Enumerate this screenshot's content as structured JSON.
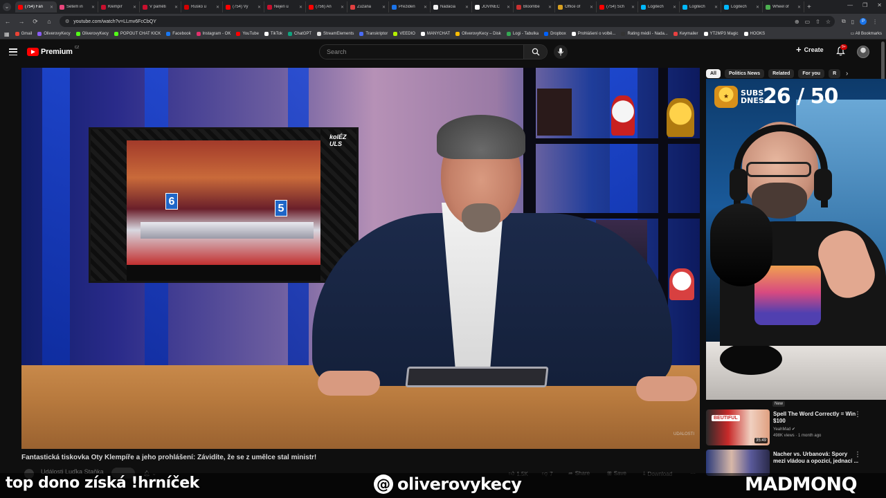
{
  "browser": {
    "tabs": [
      {
        "label": "(754) Fan",
        "color": "#ff0000",
        "active": true
      },
      {
        "label": "Šetem in",
        "color": "#e8467c"
      },
      {
        "label": "Klempíř",
        "color": "#c8102e"
      },
      {
        "label": "V paměti",
        "color": "#c8102e"
      },
      {
        "label": "Rusko u",
        "color": "#d40000"
      },
      {
        "label": "(754) Vy",
        "color": "#ff0000"
      },
      {
        "label": "Nejen u",
        "color": "#c8102e"
      },
      {
        "label": "(756) An",
        "color": "#ff0000"
      },
      {
        "label": "Zuzana",
        "color": "#e04040"
      },
      {
        "label": "Preziden",
        "color": "#1a73e8"
      },
      {
        "label": "Nadácia",
        "color": "#f1f1f1"
      },
      {
        "label": "JOVINEC",
        "color": "#ffffff"
      },
      {
        "label": "Bloombe",
        "color": "#c83030"
      },
      {
        "label": "Office of",
        "color": "#d8a020"
      },
      {
        "label": "(754) Sch",
        "color": "#ff0000"
      },
      {
        "label": "Logitech",
        "color": "#00b8fc"
      },
      {
        "label": "Logitech",
        "color": "#00b8fc"
      },
      {
        "label": "Logitech",
        "color": "#00b8fc"
      },
      {
        "label": "Wheel of",
        "color": "#4caf50"
      }
    ],
    "url": "youtube.com/watch?v=LLmv6FcCbQY",
    "bookmarks": [
      {
        "label": "Gmail",
        "color": "#ea4335"
      },
      {
        "label": "OliverovyKecy",
        "color": "#8a5cf6"
      },
      {
        "label": "OliverovyKecy",
        "color": "#53fc18"
      },
      {
        "label": "POPOUT CHAT KICK",
        "color": "#53fc18"
      },
      {
        "label": "Facebook",
        "color": "#1877f2"
      },
      {
        "label": "Instagram - OK",
        "color": "#e1306c"
      },
      {
        "label": "YouTube",
        "color": "#ff0000"
      },
      {
        "label": "TikTok",
        "color": "#ffffff"
      },
      {
        "label": "ChatGPT",
        "color": "#10a37f"
      },
      {
        "label": "StreamElements",
        "color": "#dddddd"
      },
      {
        "label": "Transkriptor",
        "color": "#4a6cf7"
      },
      {
        "label": "VEEDIO",
        "color": "#b4f000"
      },
      {
        "label": "MANYCHAT",
        "color": "#ffffff"
      },
      {
        "label": "OliverovyKecy – Disk",
        "color": "#fbbc04"
      },
      {
        "label": "Logi - Tabulka",
        "color": "#34a853"
      },
      {
        "label": "Dropbox",
        "color": "#0061ff"
      },
      {
        "label": "Prohlášení o volbě...",
        "color": "#ffffff"
      },
      {
        "label": "Rating médií - Nada...",
        "color": "#333333"
      },
      {
        "label": "Keymailer",
        "color": "#e84040"
      },
      {
        "label": "YT2MP3 Magic",
        "color": "#ffffff"
      },
      {
        "label": "HOOKS",
        "color": "#ffffff"
      }
    ],
    "all_bookmarks": "All Bookmarks"
  },
  "header": {
    "logo_word": "Premium",
    "logo_country": "CZ",
    "search_placeholder": "Search",
    "create_label": "Create",
    "notif_count": "9+"
  },
  "chips": [
    "All",
    "Politics News",
    "Related",
    "For you",
    "R"
  ],
  "cam_overlay": {
    "subs_label_1": "SUBS",
    "subs_label_2": "DNES",
    "subs_count": "26 / 50"
  },
  "video": {
    "tv_logo": "kolÉZ ULS",
    "tv_number_left": "6",
    "tv_number_right": "5",
    "watermark": "UDÁLOSTI",
    "title": "Fantastická tiskovka Oty Klempíře a jeho prohlášení: Závidíte, že se z umělce stal ministr!",
    "channel": "Události Luďka Staňka",
    "likes": "1.5K",
    "dislikes": "7",
    "share": "Share",
    "save": "Save",
    "download": "Download"
  },
  "related": [
    {
      "thumb_label": "BEUTIFUL",
      "duration": "35:49",
      "title": "Spell The Word Correctly = Win $100",
      "channel": "YeahMad",
      "meta": "498K views · 1 month ago",
      "thumb_color": "#c82a2a"
    },
    {
      "title": "Nacher vs. Urbanová: Spory mezi vládou a opozicí, jednací ...",
      "thumb_color": "#3a3a6a"
    }
  ],
  "related_new_badge": "New",
  "overlay": {
    "left_text": "top dono získá !hrníček",
    "threads_handle": "oliverovykecy",
    "right_text": "MADMONQ"
  }
}
